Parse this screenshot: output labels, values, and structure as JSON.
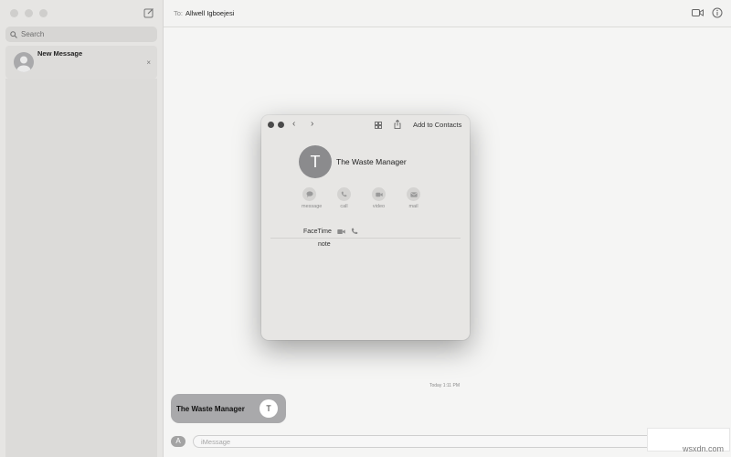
{
  "sidebar": {
    "search": {
      "placeholder": "Search"
    },
    "conversation": {
      "title": "New Message",
      "close": "×"
    }
  },
  "header": {
    "to_label": "To:",
    "recipient": "Allwell Igboejesi"
  },
  "contact_card": {
    "initial": "T",
    "name": "The Waste Manager",
    "add_to_contacts": "Add to Contacts",
    "actions": [
      {
        "label": "message"
      },
      {
        "label": "call"
      },
      {
        "label": "video"
      },
      {
        "label": "mail"
      }
    ],
    "facetime_label": "FaceTime",
    "note_label": "note"
  },
  "chat": {
    "timestamp": "Today 1:11 PM",
    "bubble_text": "The Waste Manager",
    "bubble_initial": "T",
    "input_placeholder": "iMessage"
  },
  "watermark": "wsxdn.com",
  "colors": {
    "bubble": "#a9a9ab",
    "sidebar": "#e6e5e3",
    "card": "#e7e6e4"
  }
}
